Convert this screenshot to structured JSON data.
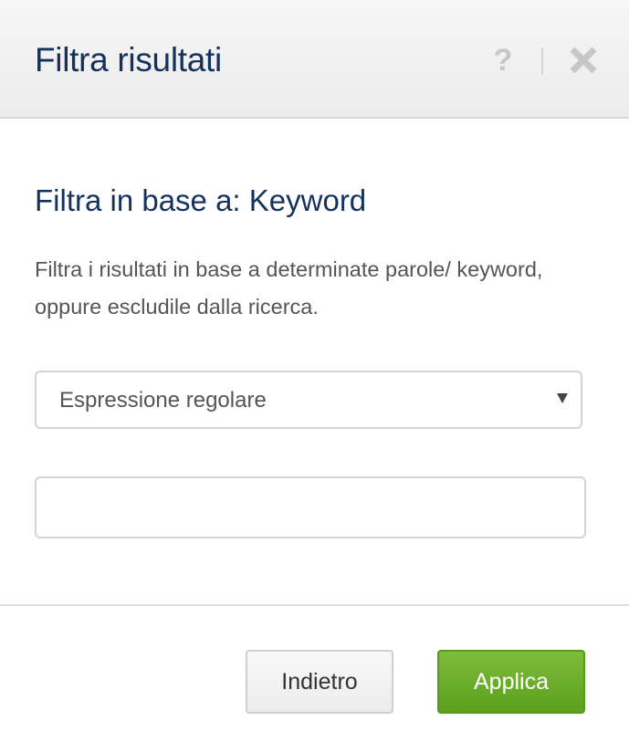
{
  "dialog": {
    "title": "Filtra risultati",
    "help_symbol": "?",
    "close_icon": "close-icon"
  },
  "filter": {
    "heading": "Filtra in base a: Keyword",
    "description": "Filtra i risultati in base a determinate parole/ keyword, oppure escludile dalla ricerca.",
    "match_type": {
      "selected": "Espressione regolare"
    },
    "value": {
      "text": "",
      "placeholder": ""
    }
  },
  "actions": {
    "back_label": "Indietro",
    "apply_label": "Applica"
  },
  "colors": {
    "title": "#14325c",
    "apply_button": "#6aad2b",
    "header_background": "#f0f0f0"
  }
}
